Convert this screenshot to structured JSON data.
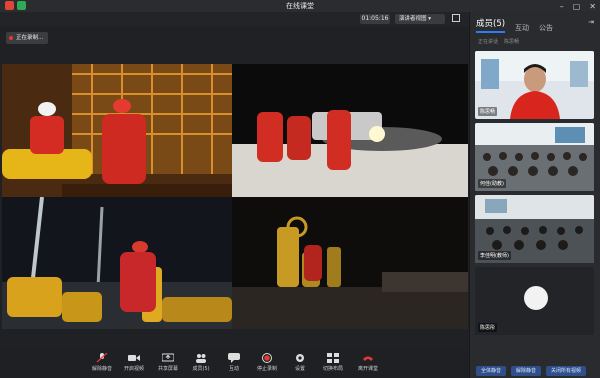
{
  "window": {
    "title": "在线课堂"
  },
  "topbar": {
    "timer": "01:05:16",
    "view_mode": "演讲者视图"
  },
  "recording": {
    "label": "正在录制..."
  },
  "toolbar": {
    "items": [
      {
        "label": "解除静音",
        "icon": "mic-muted-icon"
      },
      {
        "label": "开启视频",
        "icon": "camera-icon"
      },
      {
        "label": "共享屏幕",
        "icon": "share-screen-icon"
      },
      {
        "label": "成员(5)",
        "icon": "members-icon"
      },
      {
        "label": "互动",
        "icon": "chat-icon"
      },
      {
        "label": "停止录制",
        "icon": "record-icon"
      },
      {
        "label": "设置",
        "icon": "gear-icon"
      },
      {
        "label": "切换布局",
        "icon": "layout-icon"
      },
      {
        "label": "离开课堂",
        "icon": "hangup-icon"
      }
    ]
  },
  "panel": {
    "tabs": [
      "成员(5)",
      "互动",
      "公告"
    ],
    "subtabs": [
      "正在讲话",
      "陈思畅"
    ],
    "members": [
      {
        "name": "陈思畅"
      },
      {
        "name": "何佳(助教)"
      },
      {
        "name": "李佳明(教师)"
      },
      {
        "name": "陈思彤"
      }
    ],
    "footer_buttons": [
      "全体静音",
      "解除静音",
      "关闭所有视频"
    ]
  },
  "colors": {
    "accent": "#2f7cf6",
    "record": "#e53935",
    "background": "#202124"
  }
}
